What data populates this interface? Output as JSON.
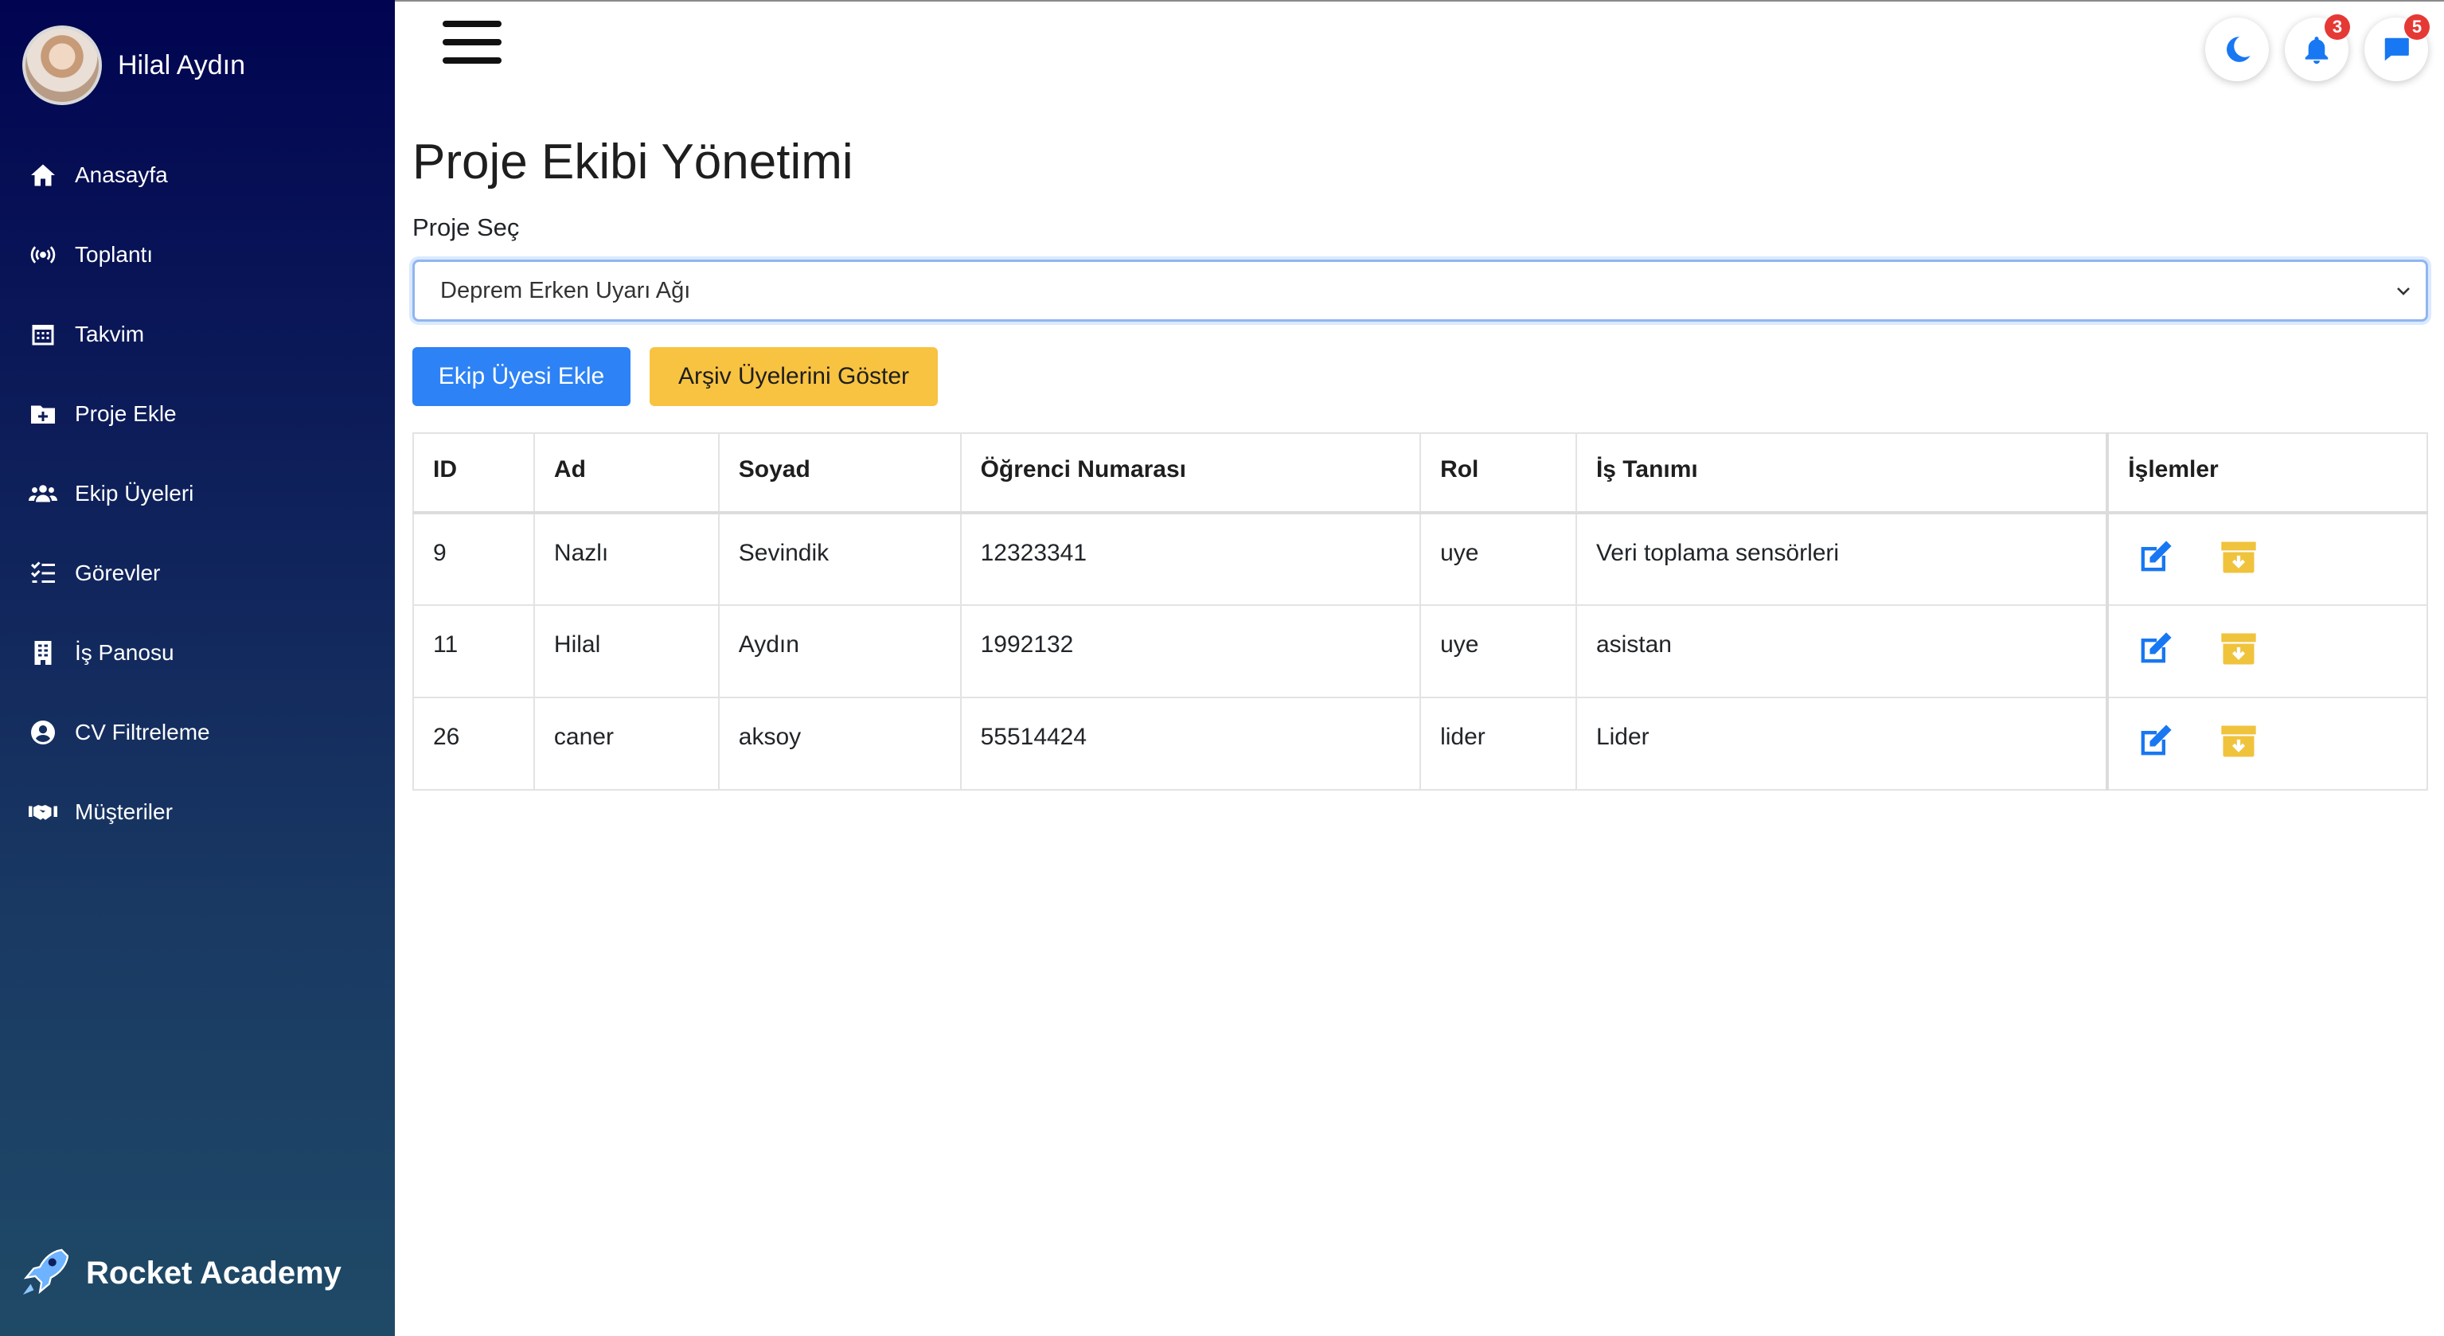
{
  "sidebar": {
    "user_name": "Hilal Aydın",
    "items": [
      {
        "label": "Anasayfa",
        "icon": "home-icon"
      },
      {
        "label": "Toplantı",
        "icon": "broadcast-icon"
      },
      {
        "label": "Takvim",
        "icon": "calendar-icon"
      },
      {
        "label": "Proje Ekle",
        "icon": "folder-plus-icon"
      },
      {
        "label": "Ekip Üyeleri",
        "icon": "users-icon"
      },
      {
        "label": "Görevler",
        "icon": "list-check-icon"
      },
      {
        "label": "İş Panosu",
        "icon": "building-icon"
      },
      {
        "label": "CV Filtreleme",
        "icon": "user-circle-icon"
      },
      {
        "label": "Müşteriler",
        "icon": "handshake-icon"
      }
    ],
    "brand": "Rocket Academy"
  },
  "topbar": {
    "notifications_count": "3",
    "messages_count": "5"
  },
  "main": {
    "title": "Proje Ekibi Yönetimi",
    "select_label": "Proje Seç",
    "selected_project": "Deprem Erken Uyarı Ağı",
    "add_button": "Ekip Üyesi Ekle",
    "archive_button": "Arşiv Üyelerini Göster"
  },
  "table": {
    "headers": [
      "ID",
      "Ad",
      "Soyad",
      "Öğrenci Numarası",
      "Rol",
      "İş Tanımı",
      "İşlemler"
    ],
    "rows": [
      [
        "9",
        "Nazlı",
        "Sevindik",
        "12323341",
        "uye",
        "Veri toplama sensörleri"
      ],
      [
        "11",
        "Hilal",
        "Aydın",
        "1992132",
        "uye",
        "asistan"
      ],
      [
        "26",
        "caner",
        "aksoy",
        "55514424",
        "lider",
        "Lider"
      ]
    ]
  },
  "colors": {
    "primary": "#2d82f5",
    "warning": "#f8c341",
    "badge": "#e53935",
    "sidebar_top": "#010451",
    "sidebar_bottom": "#1f4a67"
  }
}
